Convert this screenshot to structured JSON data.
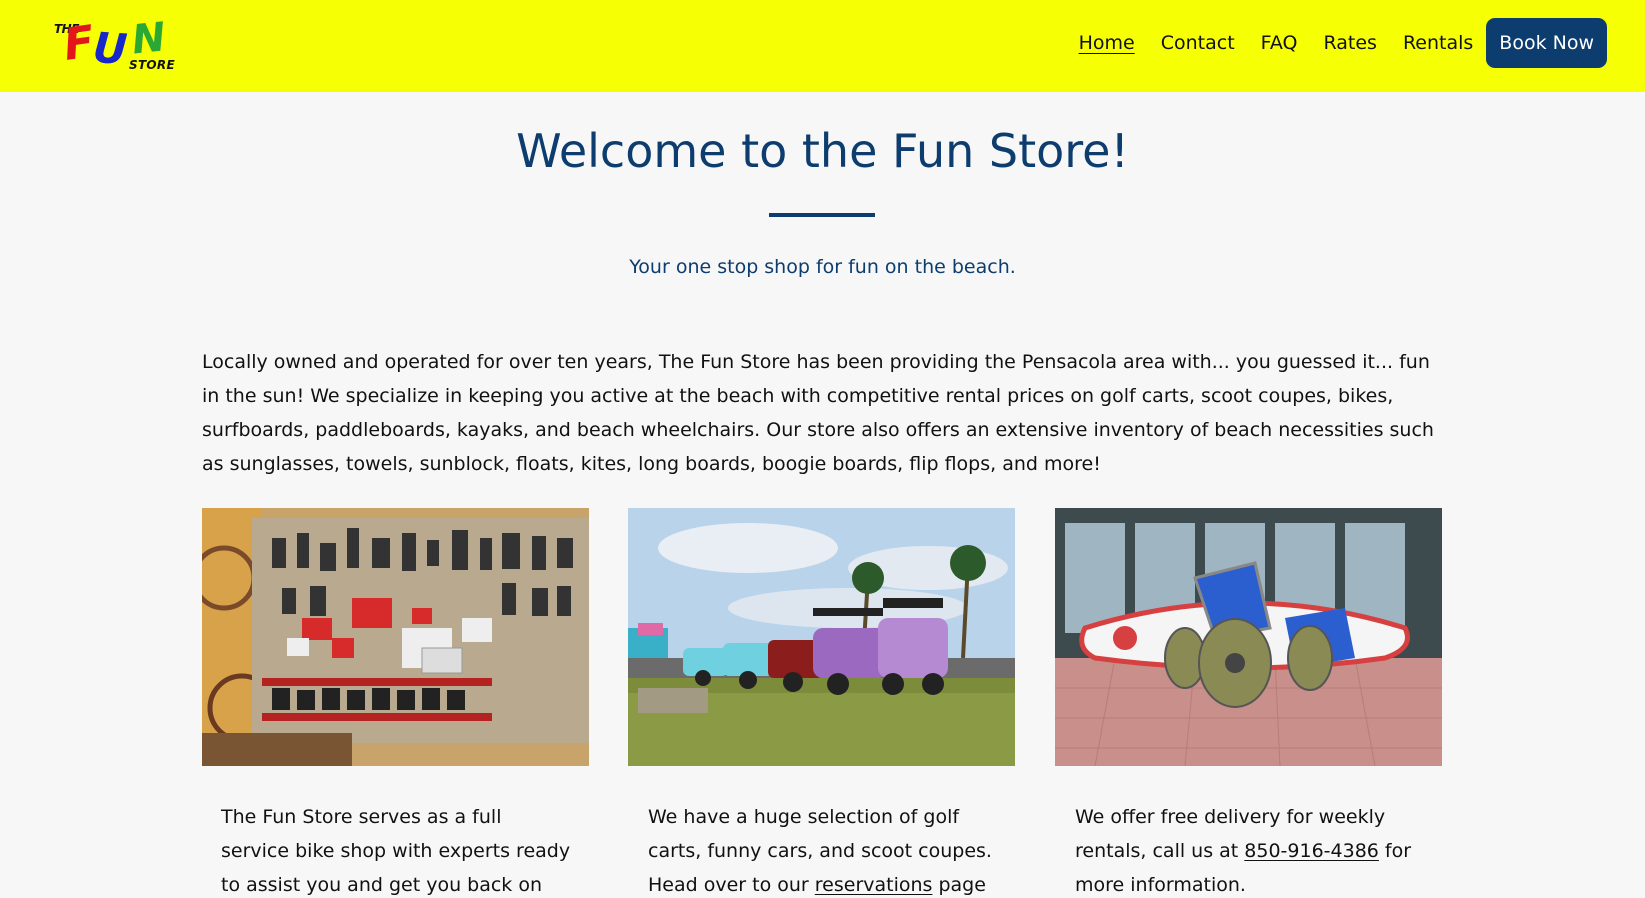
{
  "logo": {
    "the": "THE",
    "f": "F",
    "u": "U",
    "n": "N",
    "store": "STORE"
  },
  "nav": {
    "items": [
      {
        "label": "Home",
        "active": true
      },
      {
        "label": "Contact"
      },
      {
        "label": "FAQ"
      },
      {
        "label": "Rates"
      },
      {
        "label": "Rentals"
      }
    ],
    "book_label": "Book Now"
  },
  "hero": {
    "title": "Welcome to the Fun Store!",
    "tagline": "Your one stop shop for fun on the beach."
  },
  "intro": "Locally owned and operated for over ten years, The Fun Store has been providing the Pensacola area with... you guessed it... fun in the sun! We specialize in keeping you active at the beach with competitive rental prices on golf carts, scoot coupes, bikes, surfboards, paddleboards, kayaks, and beach wheelchairs. Our store also offers an extensive inventory of beach necessities such as sunglasses, towels, sunblock, floats, kites, long boards, boogie boards, flip flops, and more!",
  "cards": [
    {
      "text": "The Fun Store serves as a full service bike shop with experts ready to assist you and get you back on the road, just"
    },
    {
      "text_before": "We have a huge selection of golf carts, funny cars, and scoot coupes. Head over to our ",
      "link": "reservations",
      "text_after": " page to book"
    },
    {
      "text_before": "We offer free delivery for weekly rentals, call us at ",
      "link": "850-916-4386",
      "text_after": " for more information."
    }
  ],
  "colors": {
    "header_bg": "#f7ff05",
    "brand_navy": "#0d3d6e",
    "page_bg": "#f7f7f7"
  }
}
